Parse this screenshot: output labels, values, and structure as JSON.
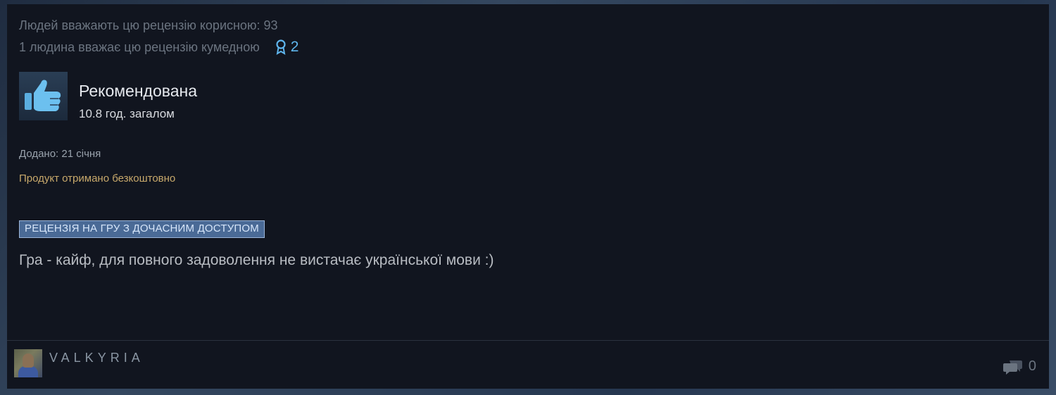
{
  "review": {
    "helpful_text": "Людей вважають цю рецензію корисною: 93",
    "funny_text": "1 людина вважає цю рецензію кумедною",
    "award_count": "2",
    "verdict": "Рекомендована",
    "hours": "10.8 год. загалом",
    "posted": "Додано: 21 січня",
    "free_product": "Продукт отримано безкоштовно",
    "early_access_badge": "РЕЦЕНЗІЯ НА ГРУ З ДОЧАСНИМ ДОСТУПОМ",
    "text": "Гра - кайф, для повного задоволення не вистачає української мови :)"
  },
  "author": {
    "username": "VALKYRIA"
  },
  "footer": {
    "comment_count": "0"
  },
  "colors": {
    "card_bg": "#11151f",
    "accent_blue": "#5fb6ee",
    "free_gold": "#c8a96b",
    "badge_bg": "#4a6a96"
  },
  "icons": {
    "award": "award-ribbon-icon",
    "thumb": "thumbs-up-icon",
    "comments": "comment-bubbles-icon"
  }
}
